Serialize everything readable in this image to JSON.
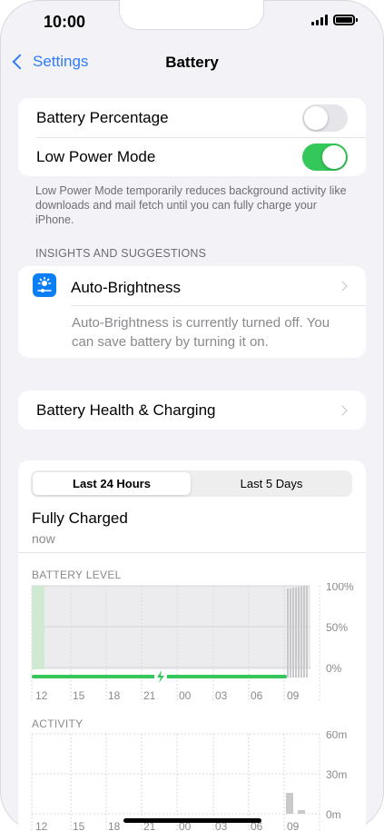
{
  "status": {
    "time": "10:00"
  },
  "nav": {
    "back_label": "Settings",
    "title": "Battery"
  },
  "settings": {
    "battery_percentage": {
      "label": "Battery Percentage",
      "enabled": false
    },
    "low_power_mode": {
      "label": "Low Power Mode",
      "enabled": true
    },
    "low_power_footnote": "Low Power Mode temporarily reduces background activity like downloads and mail fetch until you can fully charge your iPhone."
  },
  "insights": {
    "header": "INSIGHTS AND SUGGESTIONS",
    "auto_brightness": {
      "label": "Auto-Brightness",
      "icon": "brightness-icon",
      "description": "Auto-Brightness is currently turned off. You can save battery by turning it on."
    }
  },
  "battery_health": {
    "label": "Battery Health & Charging"
  },
  "usage": {
    "tabs": [
      {
        "label": "Last 24 Hours",
        "selected": true
      },
      {
        "label": "Last 5 Days",
        "selected": false
      }
    ],
    "status_title": "Fully Charged",
    "status_time": "now"
  },
  "colors": {
    "accent": "#2f7cf6",
    "toggle_on": "#34c759",
    "chart_green": "#34c759",
    "chart_gray": "#c9c9cc",
    "icon_blue": "#0a7ff5"
  },
  "chart_data": [
    {
      "type": "bar",
      "title": "BATTERY LEVEL",
      "x_ticks": [
        "12",
        "15",
        "18",
        "21",
        "00",
        "03",
        "06",
        "09"
      ],
      "y_ticks": [
        "100%",
        "50%",
        "0%"
      ],
      "ylim": [
        0,
        100
      ],
      "charging_marker": "lightning-icon",
      "note": "green charging bar near start; battery level line at 100% from 12 to 09; gray bars for last hour"
    },
    {
      "type": "bar",
      "title": "ACTIVITY",
      "x_ticks": [
        "12",
        "15",
        "18",
        "21",
        "00",
        "03",
        "06",
        "09"
      ],
      "y_ticks": [
        "60m",
        "30m",
        "0m"
      ],
      "ylim": [
        0,
        60
      ],
      "values_minutes_last_hours": [
        16,
        3
      ]
    }
  ]
}
